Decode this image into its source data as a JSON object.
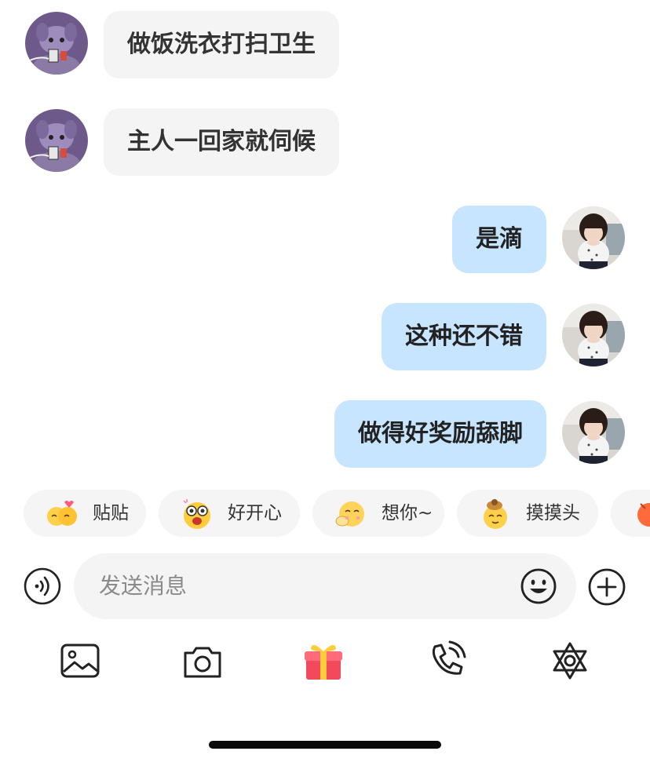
{
  "messages": [
    {
      "side": "in",
      "text": "做饭洗衣打扫卫生",
      "avatar": "cartoon-character-avatar"
    },
    {
      "side": "in",
      "text": "主人一回家就伺候",
      "avatar": "cartoon-character-avatar"
    },
    {
      "side": "out",
      "text": "是滴",
      "avatar": "user-photo-avatar"
    },
    {
      "side": "out",
      "text": "这种还不错",
      "avatar": "user-photo-avatar"
    },
    {
      "side": "out",
      "text": "做得好奖励舔脚",
      "avatar": "user-photo-avatar"
    }
  ],
  "quick_stickers": [
    {
      "label": "贴贴",
      "icon": "hug-face-icon"
    },
    {
      "label": "好开心",
      "icon": "happy-face-icon"
    },
    {
      "label": "想你~",
      "icon": "miss-you-face-icon"
    },
    {
      "label": "摸摸头",
      "icon": "pat-head-face-icon"
    }
  ],
  "composer": {
    "placeholder": "发送消息",
    "voice_icon": "voice-icon",
    "emoji_icon": "emoji-icon",
    "plus_icon": "plus-icon"
  },
  "toolbar": {
    "items": [
      "image-icon",
      "camera-icon",
      "gift-icon",
      "phone-call-icon",
      "star-of-david-icon"
    ]
  },
  "colors": {
    "incoming_bubble": "#f4f4f4",
    "outgoing_bubble": "#c7e5ff",
    "chip_bg": "#f5f5f5",
    "gift_red": "#f2495c",
    "gift_yellow": "#ffcc3a"
  }
}
